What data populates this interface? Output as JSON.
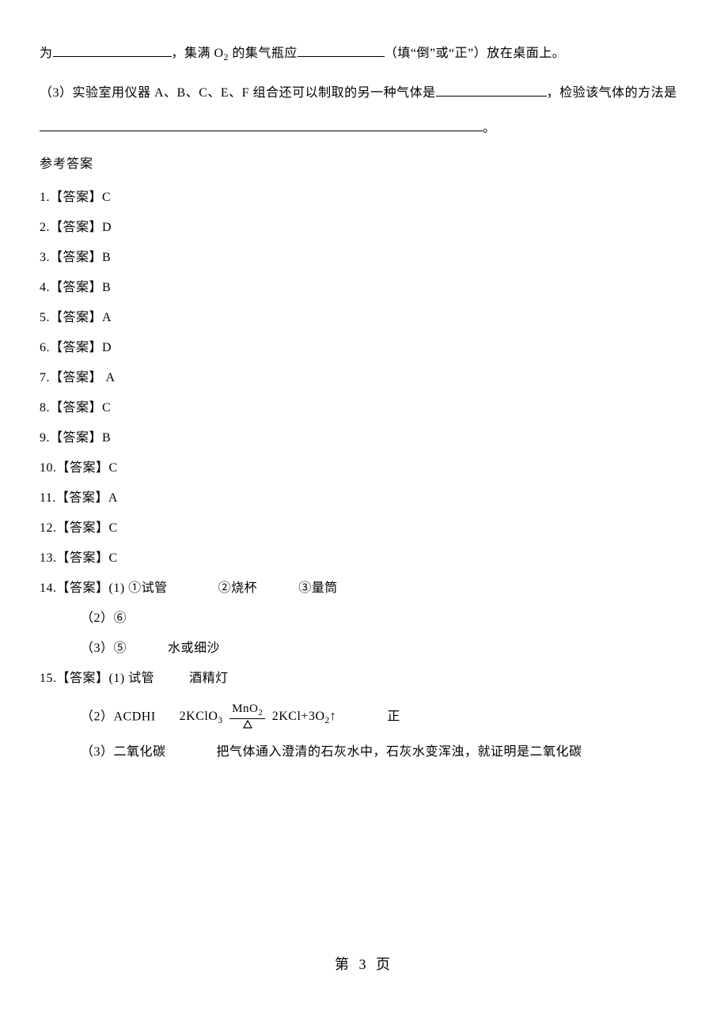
{
  "q_fragment": {
    "line1_a": "为",
    "line1_b": "，集满 O",
    "line1_sub": "2",
    "line1_c": " 的集气瓶应",
    "line1_d": "（填“倒”或“正”）放在桌面上。",
    "line2_a": "（3）实验室用仪器 A、B、C、E、F 组合还可以制取的另一种气体是",
    "line2_b": "，检验该气体的方法是",
    "line3_end": "。"
  },
  "section_answers_title": "参考答案",
  "answers": [
    "1.【答案】C",
    "2.【答案】D",
    "3.【答案】B",
    "4.【答案】B",
    "5.【答案】A",
    "6.【答案】D",
    "7.【答案】 A",
    "8.【答案】C",
    "9.【答案】B",
    "10.【答案】C",
    "11.【答案】A",
    "12.【答案】C",
    "13.【答案】C"
  ],
  "a14": {
    "line1_lead": "14.【答案】(1) ①试管",
    "line1_b": "②烧杯",
    "line1_c": "③量筒",
    "line2": "（2）⑥",
    "line3_a": "（3）⑤",
    "line3_b": "水或细沙"
  },
  "a15": {
    "line1_lead": "15.【答案】(1) 试管",
    "line1_b": "酒精灯",
    "line2_a": "（2）ACDHI",
    "eq_left": "2KClO",
    "eq_left_sub": "3",
    "frac_top_a": "MnO",
    "frac_top_sub": "2",
    "eq_right_a": "2KCl+3O",
    "eq_right_sub": "2",
    "eq_arrow": "↑",
    "line2_end": "正",
    "line3_a": "（3）二氧化碳",
    "line3_b": "把气体通入澄清的石灰水中，石灰水变浑浊，就证明是二氧化碳"
  },
  "page_num": "第 3 页"
}
